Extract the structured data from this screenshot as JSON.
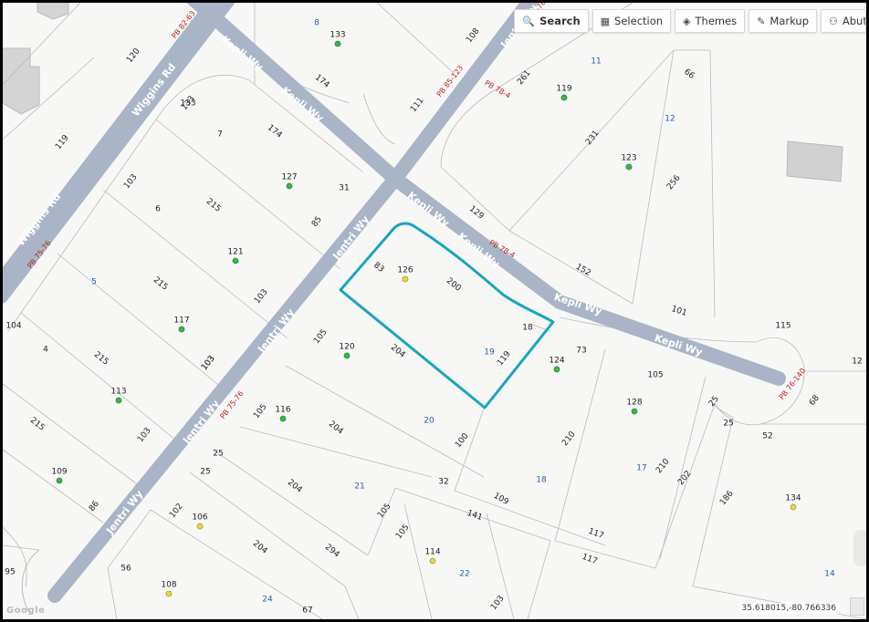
{
  "toolbar": {
    "buttons": [
      {
        "label": "Search",
        "icon": "search-icon"
      },
      {
        "label": "Selection",
        "icon": "grid-icon"
      },
      {
        "label": "Themes",
        "icon": "layers-icon"
      },
      {
        "label": "Markup",
        "icon": "pencil-icon"
      },
      {
        "label": "Abutters",
        "icon": "people-icon"
      }
    ]
  },
  "map": {
    "streets": [
      {
        "name": "Wiggins Rd"
      },
      {
        "name": "Wiggins Rd"
      },
      {
        "name": "Kepli Wy"
      },
      {
        "name": "Kepli Wy"
      },
      {
        "name": "Kepli Wy"
      },
      {
        "name": "Kepli Wy"
      },
      {
        "name": "Kepli Wy"
      },
      {
        "name": "Kepli Wy"
      },
      {
        "name": "Jentri Wy"
      },
      {
        "name": "Jentri Wy"
      },
      {
        "name": "Jentri Wy"
      },
      {
        "name": "Jentri Wy"
      },
      {
        "name": "Jentri Wy"
      }
    ],
    "plat_refs": [
      "PB 82-63",
      "PB 85-123",
      "PB 78-4",
      "PB 78-4",
      "PB 75-76",
      "PB 75-76",
      "PB 75-76",
      "PB 76-140"
    ],
    "parcel_ids": [
      "8",
      "11",
      "12",
      "5",
      "19",
      "20",
      "21",
      "18",
      "17",
      "22",
      "24",
      "14"
    ],
    "dim_labels": [
      "120",
      "119",
      "133",
      "174",
      "103",
      "108",
      "111",
      "261",
      "66",
      "231",
      "256",
      "7",
      "174",
      "133",
      "6",
      "215",
      "31",
      "85",
      "103",
      "215",
      "103",
      "129",
      "152",
      "101",
      "115",
      "12",
      "68",
      "83",
      "200",
      "18",
      "119",
      "105",
      "204",
      "73",
      "105",
      "25",
      "25",
      "52",
      "186",
      "202",
      "210",
      "104",
      "4",
      "215",
      "103",
      "215",
      "103",
      "105",
      "204",
      "100",
      "109",
      "210",
      "117",
      "117",
      "141",
      "32",
      "105",
      "105",
      "204",
      "294",
      "25",
      "25",
      "102",
      "204",
      "86",
      "95",
      "56",
      "67",
      "103"
    ],
    "house_numbers": [
      "133",
      "119",
      "123",
      "127",
      "121",
      "117",
      "126",
      "120",
      "124",
      "128",
      "113",
      "116",
      "109",
      "106",
      "114",
      "108",
      "134"
    ]
  },
  "coords": "35.618015,-80.766336",
  "attribution": "Google"
}
